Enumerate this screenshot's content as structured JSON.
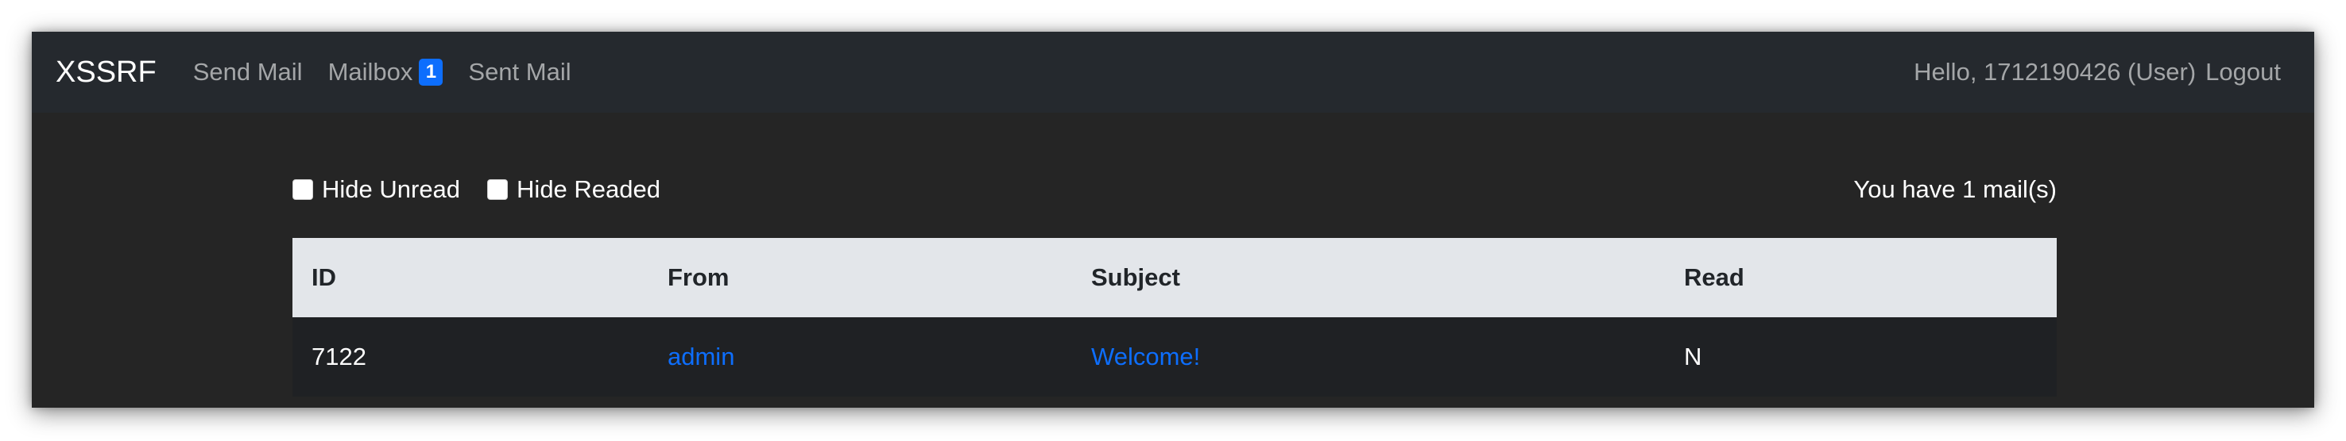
{
  "navbar": {
    "brand": "XSSRF",
    "links": [
      {
        "label": "Send Mail"
      },
      {
        "label": "Mailbox",
        "badge": "1"
      },
      {
        "label": "Sent Mail"
      }
    ],
    "greeting": "Hello, 1712190426 (User)",
    "logout": "Logout"
  },
  "filters": {
    "hide_unread": "Hide Unread",
    "hide_readed": "Hide Readed",
    "mail_count": "You have 1 mail(s)"
  },
  "table": {
    "headers": [
      "ID",
      "From",
      "Subject",
      "Read"
    ],
    "rows": [
      {
        "id": "7122",
        "from": "admin",
        "subject": "Welcome!",
        "read": "N"
      }
    ]
  },
  "colors": {
    "accent": "#0d6efd",
    "navbar_bg": "#25292e",
    "page_bg": "#252525",
    "header_bg": "#e3e6ea"
  }
}
